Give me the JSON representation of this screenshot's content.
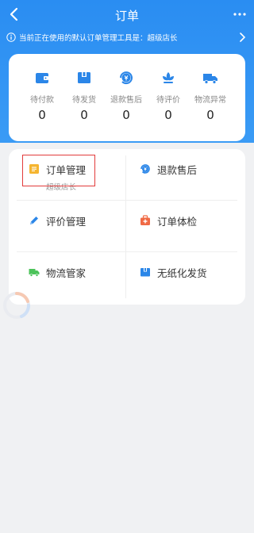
{
  "nav": {
    "title": "订单"
  },
  "notice": {
    "text": "当前正在使用的默认订单管理工具是：超级店长"
  },
  "status": [
    {
      "label": "待付款",
      "count": "0",
      "icon": "wallet-icon"
    },
    {
      "label": "待发货",
      "count": "0",
      "icon": "box-icon"
    },
    {
      "label": "退款售后",
      "count": "0",
      "icon": "refund-icon"
    },
    {
      "label": "待评价",
      "count": "0",
      "icon": "lotus-icon"
    },
    {
      "label": "物流异常",
      "count": "0",
      "icon": "truck-icon"
    }
  ],
  "tools": [
    {
      "label": "订单管理",
      "sub": "超级店长",
      "icon": "order-doc-icon"
    },
    {
      "label": "退款售后",
      "icon": "refund-icon"
    },
    {
      "label": "评价管理",
      "icon": "pen-icon"
    },
    {
      "label": "订单体检",
      "icon": "medkit-icon"
    },
    {
      "label": "物流管家",
      "icon": "truck-icon"
    },
    {
      "label": "无纸化发货",
      "icon": "box-icon"
    }
  ],
  "colors": {
    "header": "#2a8df2",
    "icon_blue": "#2b86e8",
    "accent_orange": "#f5b530",
    "accent_red": "#f06a45",
    "green": "#4cc35a",
    "highlight": "#e23b3b"
  }
}
